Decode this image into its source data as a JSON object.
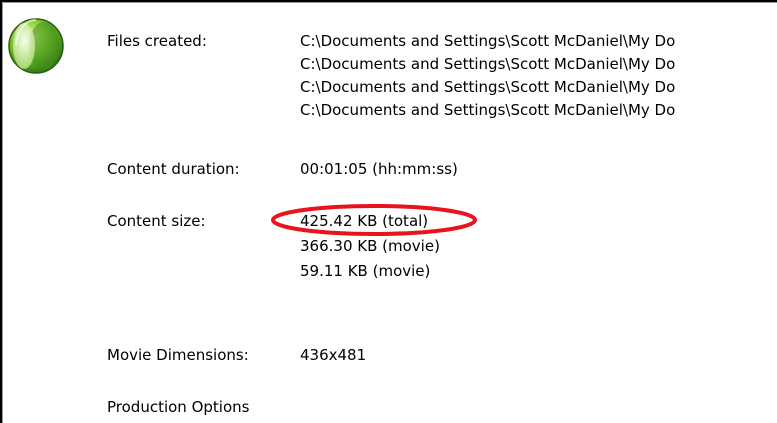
{
  "summary": {
    "files_created_label": "Files created:",
    "files_created": [
      "C:\\Documents and Settings\\Scott McDaniel\\My Do",
      "C:\\Documents and Settings\\Scott McDaniel\\My Do",
      "C:\\Documents and Settings\\Scott McDaniel\\My Do",
      "C:\\Documents and Settings\\Scott McDaniel\\My Do"
    ],
    "content_duration_label": "Content duration:",
    "content_duration_value": "00:01:05 (hh:mm:ss)",
    "content_size_label": "Content size:",
    "content_size_values": [
      "425.42 KB (total)",
      "366.30 KB (movie)",
      "59.11 KB (movie)"
    ],
    "movie_dimensions_label": "Movie Dimensions:",
    "movie_dimensions_value": "436x481",
    "production_options_label": "Production Options"
  },
  "icons": {
    "logo": "camtasia-logo-icon"
  },
  "colors": {
    "highlight": "#e8141b",
    "logo_green": "#6cbf2a"
  }
}
